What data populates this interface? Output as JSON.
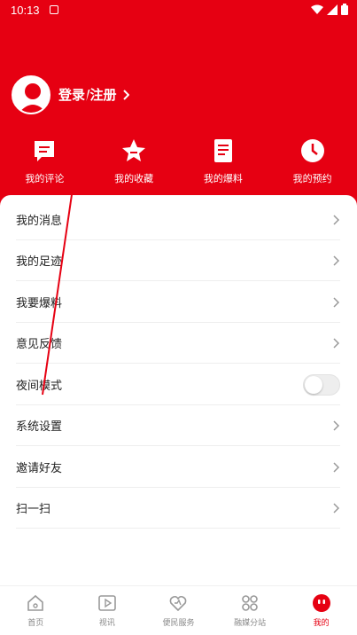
{
  "status_bar": {
    "time": "10:13"
  },
  "profile": {
    "login_label": "登录/注册"
  },
  "quick_actions": [
    {
      "label": "我的评论",
      "icon": "comment-icon"
    },
    {
      "label": "我的收藏",
      "icon": "star-icon"
    },
    {
      "label": "我的爆料",
      "icon": "document-icon"
    },
    {
      "label": "我的预约",
      "icon": "clock-icon"
    }
  ],
  "menu": [
    {
      "label": "我的消息"
    },
    {
      "label": "我的足迹"
    },
    {
      "label": "我要爆料"
    },
    {
      "label": "意见反馈"
    },
    {
      "label": "夜间模式",
      "toggle": false
    },
    {
      "label": "系统设置"
    },
    {
      "label": "邀请好友"
    },
    {
      "label": "扫一扫"
    }
  ],
  "bottom_nav": [
    {
      "label": "首页",
      "icon": "home-icon"
    },
    {
      "label": "视讯",
      "icon": "video-icon"
    },
    {
      "label": "便民服务",
      "icon": "heart-icon"
    },
    {
      "label": "融媒分站",
      "icon": "grid-icon"
    },
    {
      "label": "我的",
      "icon": "profile-icon",
      "active": true
    }
  ],
  "colors": {
    "brand": "#e60012"
  }
}
